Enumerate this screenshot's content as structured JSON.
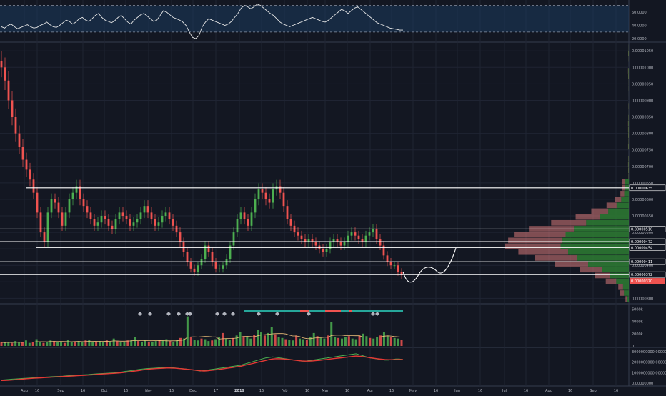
{
  "colors": {
    "background": "#131722",
    "grid": "#1f2433",
    "divider": "#363c4e",
    "axis_text": "#b2b5be",
    "up": "#26a69a",
    "up_bright": "#4caf50",
    "down": "#ef5350",
    "line_white": "#ffffff",
    "rsi_band": "#1c3a5c",
    "price_tag": "#ef5350",
    "ma_green": "#2e7d32",
    "ma_red": "#e53935"
  },
  "time_axis": {
    "labels": [
      "Aug",
      "16",
      "Sep",
      "16",
      "Oct",
      "16",
      "Nov",
      "16",
      "Dec",
      "17",
      "2019",
      "16",
      "Feb",
      "16",
      "Mar",
      "16",
      "Apr",
      "16",
      "May",
      "16",
      "Jun",
      "16",
      "Jul",
      "16",
      "Aug",
      "16",
      "Sep",
      "16"
    ],
    "bold_label": "2019"
  },
  "chart_data": [
    {
      "id": "rsi",
      "type": "line",
      "y_ticks": [
        "60.0000",
        "40.0000",
        "20.0000"
      ],
      "band_levels": [
        70,
        30
      ],
      "ylim": [
        18,
        75
      ],
      "values": [
        38,
        36,
        40,
        42,
        38,
        35,
        37,
        39,
        41,
        38,
        36,
        37,
        40,
        42,
        45,
        41,
        38,
        37,
        40,
        44,
        48,
        46,
        42,
        45,
        50,
        52,
        48,
        46,
        50,
        55,
        58,
        52,
        48,
        46,
        44,
        47,
        52,
        55,
        50,
        45,
        42,
        48,
        52,
        56,
        58,
        54,
        50,
        46,
        48,
        55,
        62,
        60,
        56,
        52,
        50,
        48,
        45,
        40,
        30,
        22,
        20,
        25,
        38,
        45,
        50,
        48,
        46,
        44,
        42,
        40,
        42,
        46,
        52,
        58,
        66,
        70,
        68,
        65,
        68,
        72,
        70,
        66,
        62,
        58,
        55,
        50,
        45,
        42,
        40,
        38,
        40,
        42,
        44,
        46,
        48,
        50,
        52,
        50,
        48,
        46,
        45,
        48,
        52,
        56,
        60,
        64,
        62,
        58,
        62,
        66,
        68,
        64,
        60,
        56,
        52,
        48,
        44,
        42,
        40,
        38,
        36,
        35,
        34,
        33,
        33
      ]
    },
    {
      "id": "price",
      "type": "candlestick",
      "y_ticks": [
        "0.00001050",
        "0.00001000",
        "0.00000950",
        "0.00000900",
        "0.00000850",
        "0.00000800",
        "0.00000750",
        "0.00000700",
        "0.00000650",
        "0.00000600",
        "0.00000550",
        "0.00000500",
        "0.00000450",
        "0.00000400",
        "0.00000350",
        "0.00000300"
      ],
      "ylim": [
        2.9e-06,
        1.07e-05
      ],
      "horizontal_levels": [
        {
          "label": "0.00000635",
          "value": 6.35e-06
        },
        {
          "label": "0.00000510",
          "value": 5.1e-06
        },
        {
          "label": "0.00000472",
          "value": 4.72e-06
        },
        {
          "label": "0.00000454",
          "value": 4.54e-06
        },
        {
          "label": "0.00000411",
          "value": 4.11e-06
        },
        {
          "label": "0.00000372",
          "value": 3.72e-06
        }
      ],
      "last_price_label": "0.00000370",
      "close_series": [
        1000,
        960,
        900,
        850,
        800,
        760,
        720,
        690,
        660,
        620,
        560,
        500,
        470,
        560,
        600,
        590,
        560,
        520,
        560,
        600,
        620,
        640,
        600,
        580,
        560,
        540,
        520,
        530,
        550,
        540,
        520,
        510,
        540,
        560,
        550,
        540,
        520,
        530,
        540,
        560,
        580,
        560,
        540,
        520,
        530,
        550,
        560,
        540,
        520,
        500,
        470,
        440,
        410,
        390,
        380,
        400,
        420,
        460,
        440,
        410,
        390,
        390,
        400,
        420,
        460,
        500,
        540,
        560,
        540,
        520,
        560,
        600,
        630,
        620,
        600,
        590,
        630,
        640,
        620,
        580,
        540,
        520,
        500,
        490,
        480,
        470,
        480,
        470,
        460,
        450,
        440,
        450,
        470,
        480,
        470,
        460,
        470,
        490,
        500,
        490,
        480,
        470,
        490,
        500,
        510,
        480,
        460,
        430,
        410,
        400,
        400,
        380,
        370
      ]
    },
    {
      "id": "volume",
      "type": "bar",
      "y_ticks": [
        "6000k",
        "4000k",
        "2000k",
        "0"
      ],
      "ylim": [
        0,
        6500
      ],
      "values": [
        600,
        500,
        700,
        450,
        800,
        550,
        600,
        900,
        500,
        650,
        1100,
        700,
        500,
        600,
        900,
        800,
        700,
        650,
        500,
        1000,
        600,
        700,
        800,
        600,
        900,
        1000,
        700,
        600,
        800,
        700,
        900,
        600,
        1200,
        800,
        700,
        650,
        900,
        1000,
        1400,
        800,
        700,
        900,
        600,
        700,
        800,
        1000,
        900,
        1100,
        800,
        700,
        1000,
        1300,
        1200,
        4800,
        1500,
        1000,
        900,
        1200,
        1100,
        800,
        900,
        1100,
        1500,
        2100,
        1200,
        1000,
        1300,
        1700,
        2300,
        1600,
        1400,
        1200,
        1800,
        2600,
        2200,
        1700,
        2100,
        3100,
        1900,
        1500,
        1300,
        1100,
        1000,
        900,
        1700,
        1200,
        1100,
        1000,
        1400,
        2100,
        1600,
        1300,
        1200,
        1700,
        3900,
        1500,
        1300,
        1200,
        1400,
        1600,
        1200,
        1100,
        1700,
        2000,
        1600,
        1300,
        1200,
        1500,
        1700,
        2200,
        1600,
        1400,
        1300,
        1200,
        1000
      ]
    },
    {
      "id": "indicator",
      "type": "line",
      "y_ticks": [
        "3000000000.0000000",
        "2000000000.0000000",
        "1000000000.0000000",
        "0.00000000"
      ],
      "ylim": [
        0,
        3200000000
      ],
      "series": [
        {
          "color": "#4caf50",
          "values": [
            300,
            320,
            350,
            380,
            400,
            420,
            450,
            470,
            500,
            520,
            540,
            560,
            580,
            600,
            620,
            640,
            650,
            660,
            700,
            720,
            740,
            760,
            780,
            800,
            820,
            850,
            880,
            900,
            920,
            940,
            960,
            980,
            1000,
            1050,
            1100,
            1150,
            1200,
            1250,
            1300,
            1350,
            1380,
            1400,
            1420,
            1450,
            1480,
            1500,
            1520,
            1480,
            1450,
            1400,
            1380,
            1350,
            1300,
            1250,
            1200,
            1150,
            1200,
            1250,
            1300,
            1350,
            1400,
            1450,
            1500,
            1550,
            1600,
            1650,
            1700,
            1800,
            1900,
            2000,
            2100,
            2200,
            2300,
            2400,
            2450,
            2500,
            2450,
            2400,
            2350,
            2300,
            2250,
            2200,
            2150,
            2100,
            2100,
            2150,
            2200,
            2250,
            2300,
            2350,
            2400,
            2450,
            2500,
            2550,
            2600,
            2650,
            2700,
            2750,
            2800,
            2700,
            2600,
            2500,
            2400,
            2350,
            2300,
            2250,
            2200,
            2200,
            2250,
            2300,
            2300,
            2250
          ]
        },
        {
          "color": "#e53935",
          "values": [
            250,
            260,
            280,
            300,
            330,
            360,
            390,
            420,
            450,
            470,
            490,
            510,
            530,
            550,
            570,
            590,
            610,
            630,
            650,
            670,
            690,
            710,
            730,
            750,
            770,
            790,
            820,
            850,
            870,
            890,
            910,
            930,
            960,
            990,
            1030,
            1070,
            1110,
            1150,
            1200,
            1250,
            1300,
            1340,
            1370,
            1390,
            1410,
            1430,
            1450,
            1440,
            1420,
            1390,
            1360,
            1330,
            1300,
            1260,
            1220,
            1180,
            1160,
            1180,
            1220,
            1260,
            1300,
            1350,
            1400,
            1450,
            1500,
            1550,
            1600,
            1680,
            1760,
            1840,
            1920,
            2000,
            2080,
            2160,
            2240,
            2300,
            2330,
            2320,
            2300,
            2270,
            2230,
            2190,
            2150,
            2120,
            2100,
            2100,
            2120,
            2150,
            2180,
            2220,
            2260,
            2300,
            2340,
            2380,
            2420,
            2460,
            2500,
            2540,
            2580,
            2560,
            2520,
            2470,
            2420,
            2370,
            2320,
            2280,
            2250,
            2230,
            2230,
            2240,
            2250,
            2240
          ]
        }
      ]
    }
  ]
}
